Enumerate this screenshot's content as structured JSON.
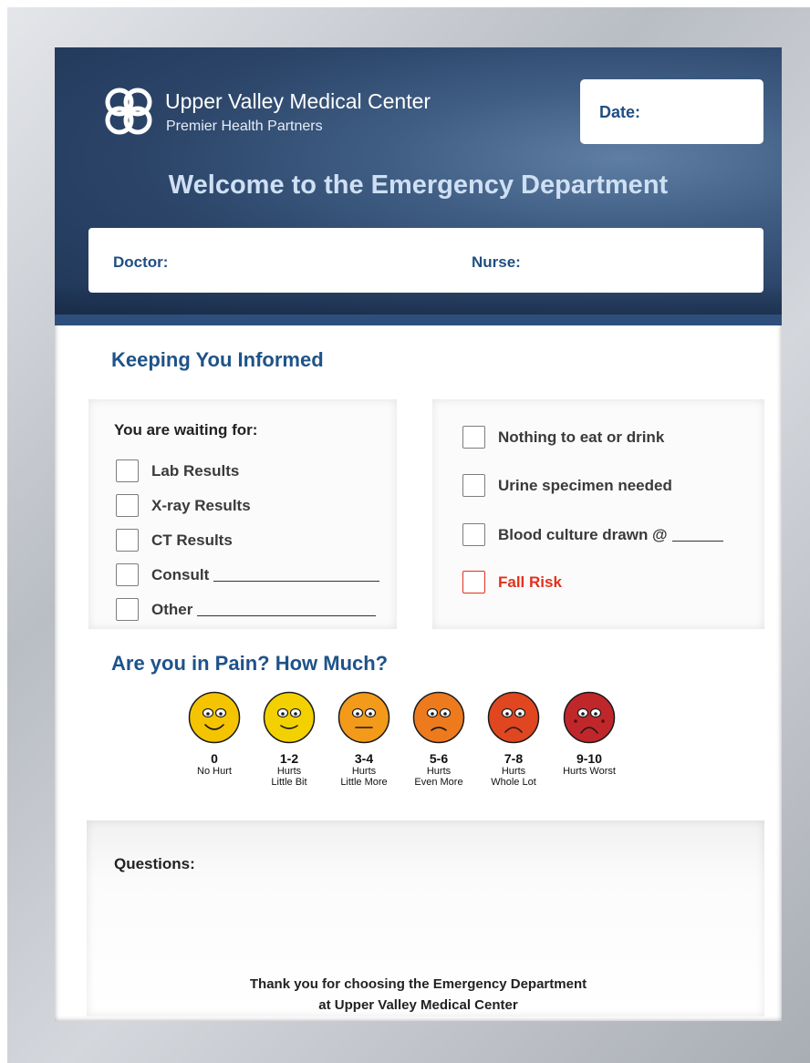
{
  "header": {
    "org_name": "Upper Valley Medical Center",
    "org_sub": "Premier Health Partners",
    "date_label": "Date:",
    "welcome": "Welcome to the Emergency Department",
    "doctor_label": "Doctor:",
    "nurse_label": "Nurse:"
  },
  "informed": {
    "title": "Keeping You Informed",
    "waiting_label": "You are waiting for:",
    "waiting_items": [
      "Lab Results",
      "X-ray Results",
      "CT Results",
      "Consult",
      "Other"
    ],
    "right_items": [
      "Nothing to eat or drink",
      "Urine specimen needed",
      "Blood culture drawn @",
      "Fall Risk"
    ]
  },
  "pain": {
    "title": "Are you in Pain? How Much?",
    "scale": [
      {
        "num": "0",
        "desc1": "No Hurt",
        "desc2": "",
        "color": "#f5c400"
      },
      {
        "num": "1-2",
        "desc1": "Hurts",
        "desc2": "Little Bit",
        "color": "#f3d100"
      },
      {
        "num": "3-4",
        "desc1": "Hurts",
        "desc2": "Little More",
        "color": "#f39a1a"
      },
      {
        "num": "5-6",
        "desc1": "Hurts",
        "desc2": "Even More",
        "color": "#ee7a1e"
      },
      {
        "num": "7-8",
        "desc1": "Hurts",
        "desc2": "Whole Lot",
        "color": "#e0461f"
      },
      {
        "num": "9-10",
        "desc1": "Hurts Worst",
        "desc2": "",
        "color": "#c0272a"
      }
    ]
  },
  "questions": {
    "label": "Questions:",
    "thanks_line1": "Thank you for choosing the Emergency Department",
    "thanks_line2": "at Upper Valley Medical Center"
  },
  "colors": {
    "brand_blue": "#1e5389",
    "fall_risk_red": "#e2311d"
  }
}
